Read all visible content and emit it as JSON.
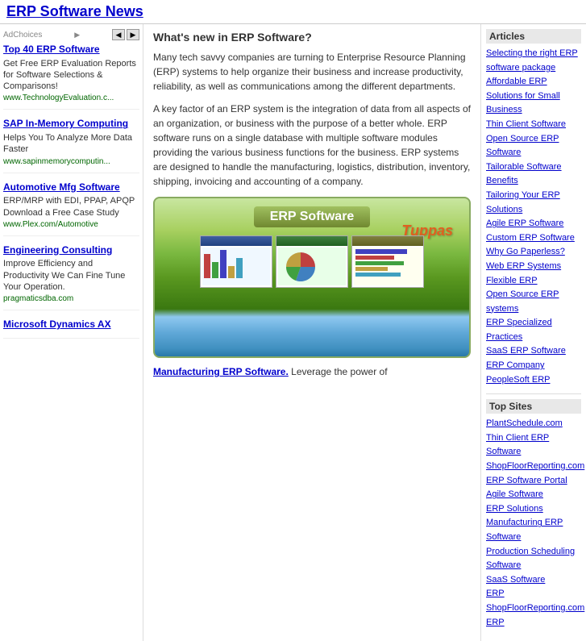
{
  "page": {
    "title": "ERP Software News",
    "title_href": "#"
  },
  "left_sidebar": {
    "ad_choices": "AdChoices",
    "ads": [
      {
        "id": "ad1",
        "title": "Top 40 ERP Software",
        "description": "Get Free ERP Evaluation Reports for Software Selections & Comparisons!",
        "url": "www.TechnologyEvaluation.c..."
      },
      {
        "id": "ad2",
        "title": "SAP In-Memory Computing",
        "description": "Helps You To Analyze More Data Faster",
        "url": "www.sapinmemorycomputin..."
      },
      {
        "id": "ad3",
        "title": "Automotive Mfg Software",
        "description": "ERP/MRP with EDI, PPAP, APQP Download a Free Case Study",
        "url": "www.Plex.com/Automotive"
      },
      {
        "id": "ad4",
        "title": "Engineering Consulting",
        "description": "Improve Efficiency and Productivity We Can Fine Tune Your Operation.",
        "url": "pragmaticsdba.com"
      },
      {
        "id": "ad5",
        "title": "Microsoft Dynamics AX",
        "description": "",
        "url": ""
      }
    ]
  },
  "main": {
    "heading": "What's new in ERP Software?",
    "paragraph1": "Many tech savvy companies are turning to Enterprise Resource Planning (ERP) systems to help organize their business and increase productivity, reliability, as well as communications among the different departments.",
    "paragraph2": "A key factor of an ERP system is the integration of data from all aspects of an organization, or business with the purpose of a better whole. ERP software runs on a single database with multiple software modules providing the various business functions for the business. ERP systems are designed to handle the manufacturing, logistics, distribution, inventory, shipping, invoicing and accounting of a company.",
    "erp_image_label": "ERP Software",
    "tuppas_label": "Tuppas",
    "bottom_link_text": "Manufacturing ERP Software.",
    "bottom_text": " Leverage the power of"
  },
  "right_sidebar": {
    "articles_title": "Articles",
    "articles": [
      "Selecting the right ERP software package",
      "Affordable ERP",
      "Solutions for Small Business",
      "Thin Client Software",
      "Open Source ERP Software",
      "Tailorable Software Benefits",
      "Tailoring Your ERP Solutions",
      "Agile ERP Software",
      "Custom ERP Software",
      "Why Go Paperless?",
      "Web ERP Systems",
      "Flexible ERP",
      "Open Source ERP systems",
      "ERP Specialized Practices",
      "SaaS ERP Software",
      "ERP Company",
      "PeopleSoft ERP"
    ],
    "top_sites_title": "Top Sites",
    "top_sites": [
      "PlantSchedule.com",
      "Thin Client ERP Software",
      "ShopFloorReporting.com",
      "ERP Software Portal",
      "Agile Software",
      "ERP Solutions",
      "Manufacturing ERP Software",
      "Production Scheduling Software",
      "SaaS Software",
      "ERP",
      "ShopFloorReporting.com",
      "ERP"
    ]
  }
}
